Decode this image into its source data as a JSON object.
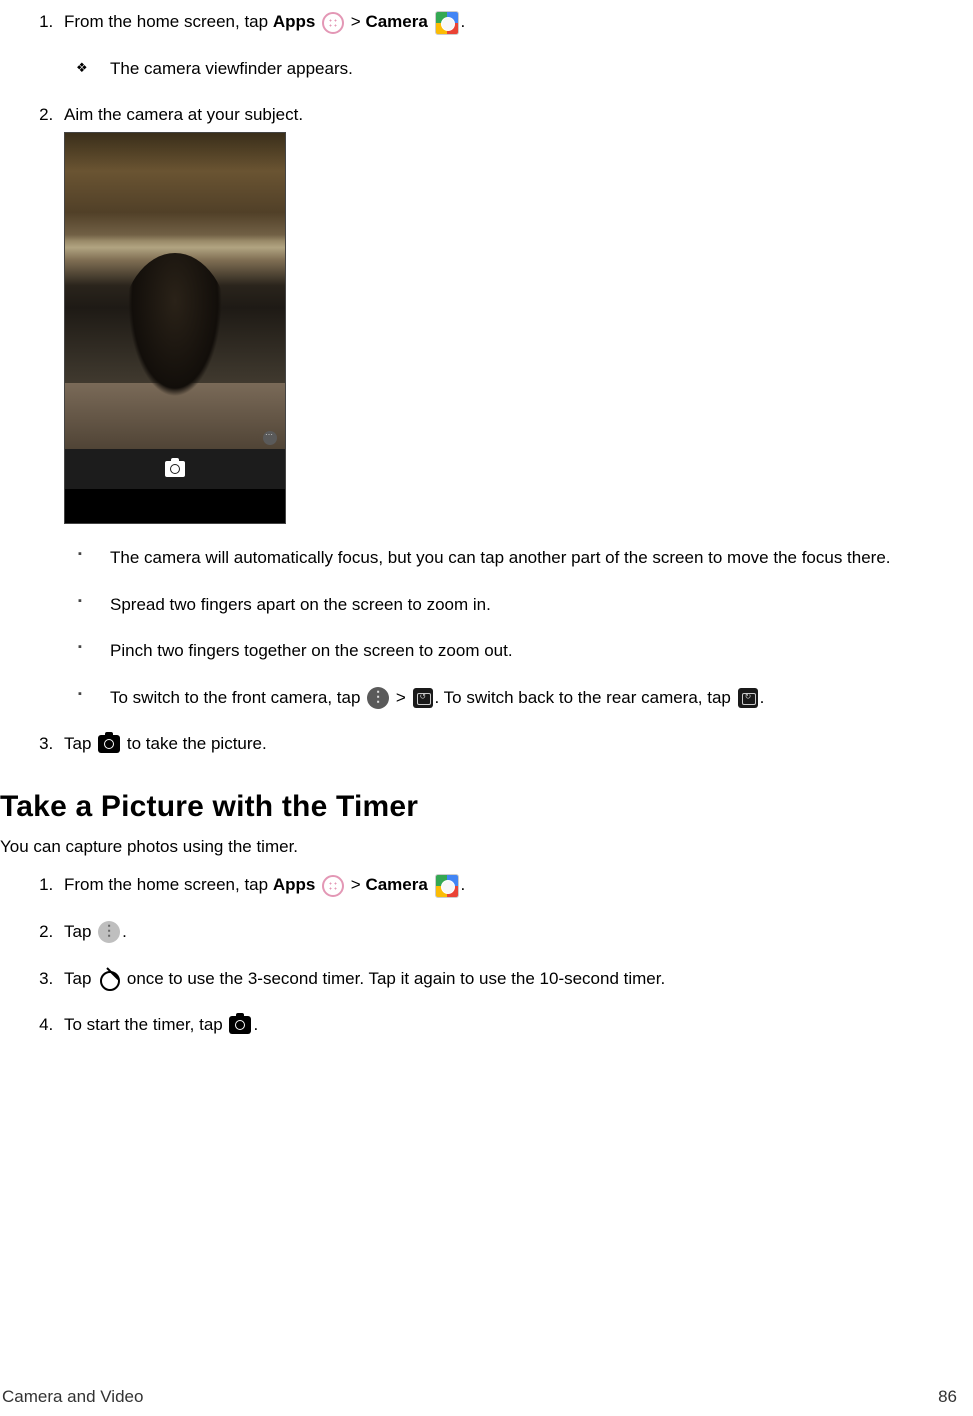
{
  "s1": {
    "li1a": "From the home screen, tap ",
    "li1_apps": "Apps",
    "li1_gt": " > ",
    "li1_camera": "Camera",
    "period": ".",
    "sub1": "The camera viewfinder appears.",
    "li2": "Aim the camera at your subject.",
    "sub2a": "The camera will automatically focus, but you can tap another part of the screen to move the focus there.",
    "sub2b": "Spread two fingers apart on the screen to zoom in.",
    "sub2c": "Pinch two fingers together on the screen to zoom out.",
    "sub2d_a": "To switch to the front camera, tap ",
    "sub2d_b": " > ",
    "sub2d_c": ". To switch back to the rear camera, tap ",
    "li3a": "Tap ",
    "li3b": " to take the picture."
  },
  "heading": "Take a Picture with the Timer",
  "lead": "You can capture photos using the timer.",
  "s2": {
    "li1a": "From the home screen, tap ",
    "li1_apps": "Apps",
    "li1_gt": " > ",
    "li1_camera": "Camera",
    "period": ".",
    "li2a": "Tap ",
    "li3a": "Tap ",
    "li3b": " once to use the 3-second timer. Tap it again to use the 10-second timer.",
    "li4a": "To start the timer, tap "
  },
  "footer": {
    "section": "Camera and Video",
    "page": "86"
  }
}
